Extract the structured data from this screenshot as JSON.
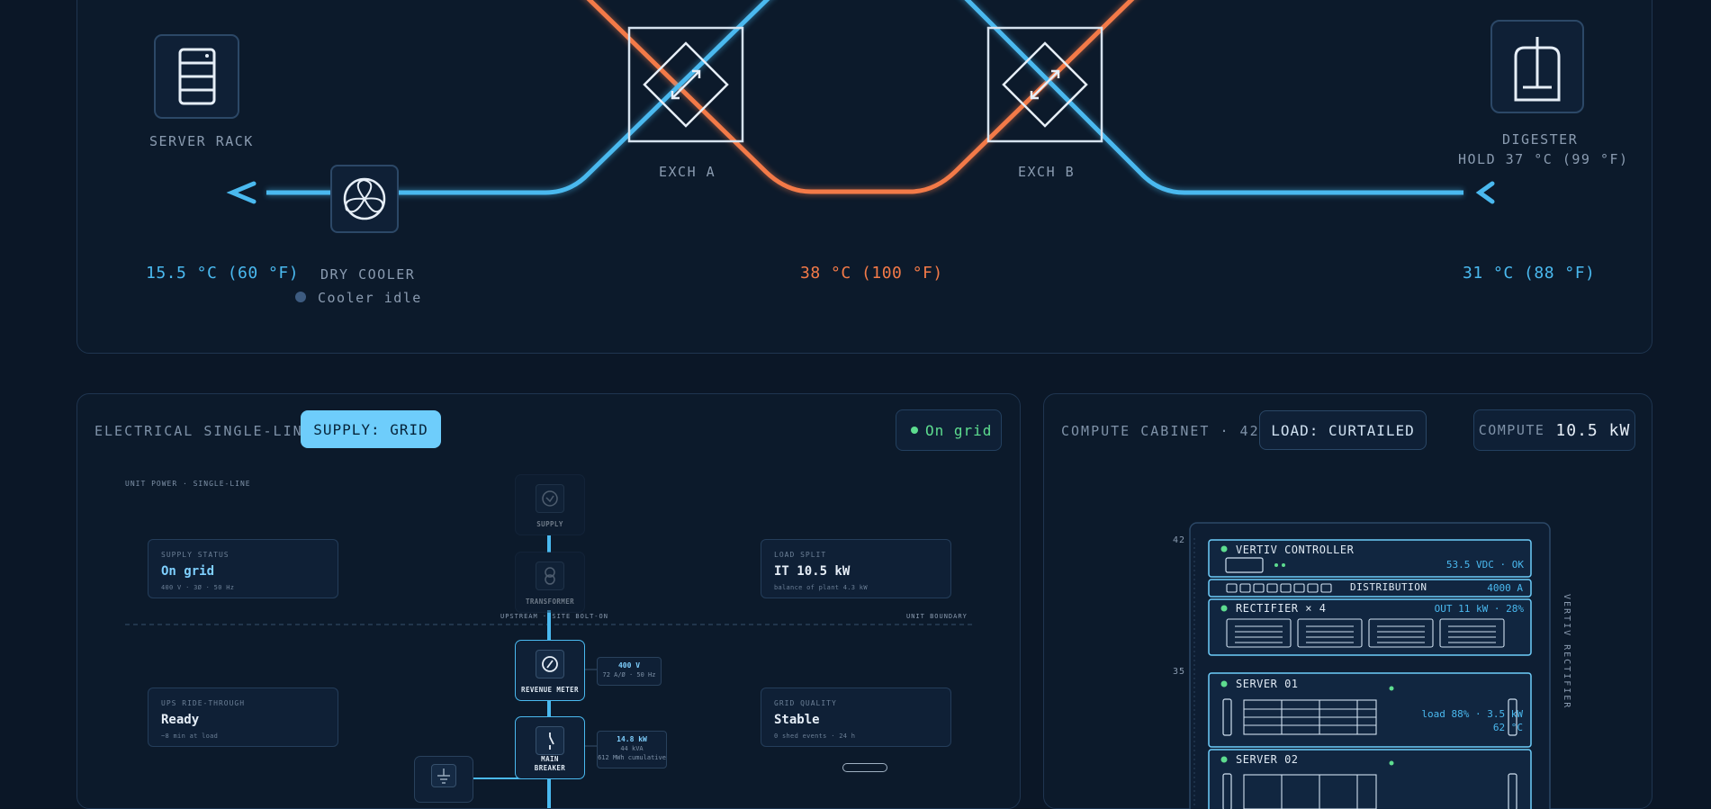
{
  "thermal": {
    "server_rack_label": "SERVER RACK",
    "exch_a_label": "EXCH A",
    "exch_b_label": "EXCH B",
    "digester_label": "DIGESTER",
    "digester_hold": "HOLD 37 °C (99 °F)",
    "dry_cooler_label": "DRY COOLER",
    "cooler_status": "Cooler idle",
    "temp_left": "15.5 °C (60 °F)",
    "temp_mid": "38 °C (100 °F)",
    "temp_right": "31 °C (88 °F)",
    "colors": {
      "cold": "#4ab9ef",
      "hot": "#f37a48"
    }
  },
  "electrical": {
    "header": "ELECTRICAL SINGLE-LINE",
    "supply_pill": "SUPPLY: GRID",
    "grid_status": "On grid",
    "diagram_title": "UNIT POWER · SINGLE-LINE",
    "upstream_label": "UPSTREAM · SITE BOLT-ON",
    "boundary_label": "UNIT BOUNDARY",
    "cards": {
      "supply_status": {
        "key": "SUPPLY STATUS",
        "value": "On grid",
        "sub": "400 V · 3Ø · 50 Hz"
      },
      "load_split": {
        "key": "LOAD SPLIT",
        "value": "IT 10.5 kW",
        "sub": "balance of plant 4.3 kW"
      },
      "ups": {
        "key": "UPS RIDE-THROUGH",
        "value": "Ready",
        "sub": "~8 min at load"
      },
      "grid_quality": {
        "key": "GRID QUALITY",
        "value": "Stable",
        "sub": "0 shed events · 24 h"
      }
    },
    "nodes": {
      "supply": "SUPPLY",
      "transformer": "TRANSFORMER",
      "revenue_meter": "REVENUE METER",
      "main_breaker_1": "MAIN",
      "main_breaker_2": "BREAKER"
    },
    "meter_readout": {
      "value": "400 V",
      "sub": "72 A/Ø · 50 Hz"
    },
    "breaker_readout": {
      "value": "14.8 kW",
      "sub1": "44 kVA",
      "sub2": "612 MWh cumulative"
    }
  },
  "compute": {
    "header": "COMPUTE CABINET · 42U",
    "load_pill": "LOAD: CURTAILED",
    "compute_label": "COMPUTE",
    "compute_value": "10.5 kW",
    "u_top": "42",
    "u_mid": "35",
    "side_label": "VERTIV RECTIFIER",
    "controller": {
      "name": "VERTIV CONTROLLER",
      "value": "53.5 VDC · OK"
    },
    "distribution": {
      "name": "DISTRIBUTION",
      "value": "4000 A"
    },
    "rectifier": {
      "name": "RECTIFIER × 4",
      "value": "OUT 11 kW · 28%"
    },
    "server1": {
      "name": "SERVER 01",
      "load": "load 88% · 3.5 kW",
      "temp": "62 °C"
    },
    "server2": {
      "name": "SERVER 02"
    }
  }
}
